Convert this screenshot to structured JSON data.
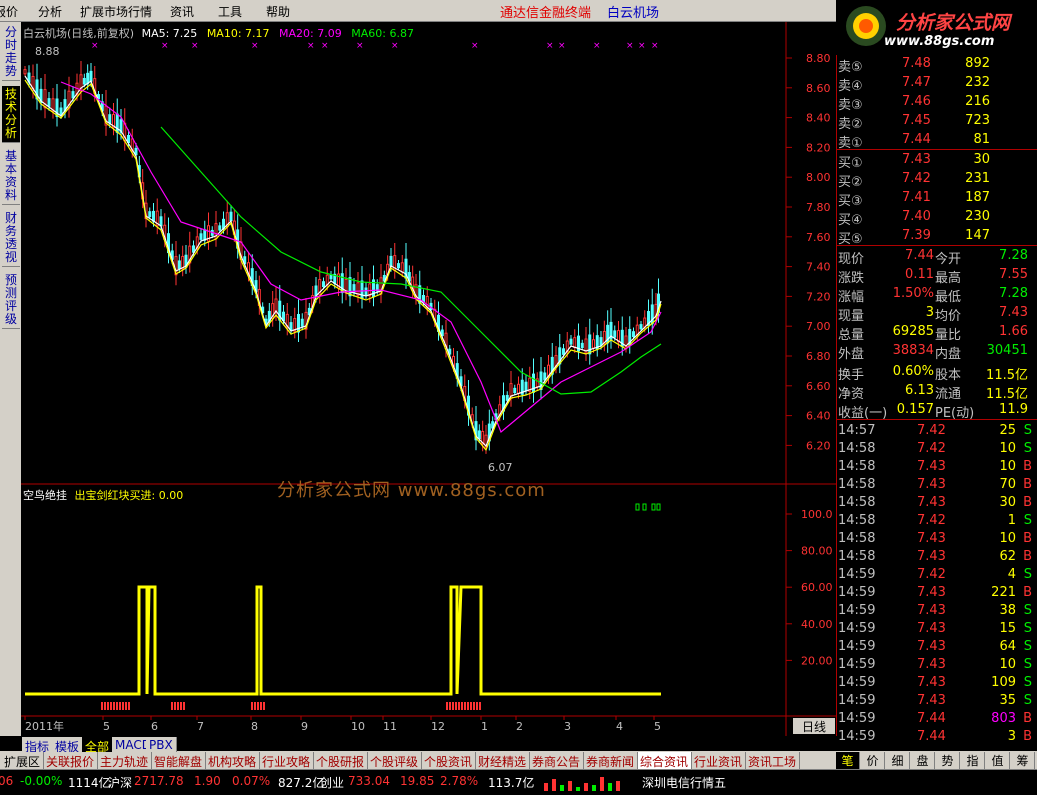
{
  "menu": {
    "items": [
      "报价",
      "分析",
      "扩展市场行情",
      "资讯",
      "工具",
      "帮助"
    ],
    "title": "通达信金融终端",
    "stock": "白云机场"
  },
  "logo": {
    "text": "分析家公式网",
    "url": "www.88gs.com"
  },
  "left_tabs": [
    "分时走势",
    "技术分析",
    "基本资料",
    "财务透视",
    "预测评级"
  ],
  "main_chart": {
    "header_name": "白云机场(日线,前复权)",
    "ma5": "MA5: 7.25",
    "ma10": "MA10: 7.17",
    "ma20": "MA20: 7.09",
    "ma60": "MA60: 6.87",
    "top_label": "8.88",
    "low_label": "6.07",
    "y_ticks": [
      "8.80",
      "8.60",
      "8.40",
      "8.20",
      "8.00",
      "7.80",
      "7.60",
      "7.40",
      "7.20",
      "7.00",
      "6.80",
      "6.60",
      "6.40",
      "6.20"
    ]
  },
  "indicator": {
    "name": "空鸟绝挂",
    "subtitle": "出宝剑红块买进: 0.00",
    "watermark": "分析家公式网 www.88gs.com",
    "y_ticks": [
      "100.0",
      "80.00",
      "60.00",
      "40.00",
      "20.00"
    ]
  },
  "date_axis": [
    "2011年",
    "5",
    "6",
    "7",
    "8",
    "9",
    "10",
    "11",
    "12",
    "1",
    "2",
    "3",
    "4",
    "5"
  ],
  "period": "日线",
  "ask": [
    {
      "label": "卖⑤",
      "price": "7.48",
      "vol": "892"
    },
    {
      "label": "卖④",
      "price": "7.47",
      "vol": "232"
    },
    {
      "label": "卖③",
      "price": "7.46",
      "vol": "216"
    },
    {
      "label": "卖②",
      "price": "7.45",
      "vol": "723"
    },
    {
      "label": "卖①",
      "price": "7.44",
      "vol": "81"
    }
  ],
  "bid": [
    {
      "label": "买①",
      "price": "7.43",
      "vol": "30"
    },
    {
      "label": "买②",
      "price": "7.42",
      "vol": "231"
    },
    {
      "label": "买③",
      "price": "7.41",
      "vol": "187"
    },
    {
      "label": "买④",
      "price": "7.40",
      "vol": "230"
    },
    {
      "label": "买⑤",
      "price": "7.39",
      "vol": "147"
    }
  ],
  "quote": [
    {
      "l1": "现价",
      "v1": "7.44",
      "c1": "#ff3333",
      "l2": "今开",
      "v2": "7.28",
      "c2": "#00ee00"
    },
    {
      "l1": "涨跌",
      "v1": "0.11",
      "c1": "#ff3333",
      "l2": "最高",
      "v2": "7.55",
      "c2": "#ff3333"
    },
    {
      "l1": "涨幅",
      "v1": "1.50%",
      "c1": "#ff3333",
      "l2": "最低",
      "v2": "7.28",
      "c2": "#00ee00"
    },
    {
      "l1": "现量",
      "v1": "3",
      "c1": "#ffff00",
      "l2": "均价",
      "v2": "7.43",
      "c2": "#ff3333"
    },
    {
      "l1": "总量",
      "v1": "69285",
      "c1": "#ffff00",
      "l2": "量比",
      "v2": "1.66",
      "c2": "#ff3333"
    },
    {
      "l1": "外盘",
      "v1": "38834",
      "c1": "#ff3333",
      "l2": "内盘",
      "v2": "30451",
      "c2": "#00ee00"
    },
    {
      "l1": "换手",
      "v1": "0.60%",
      "c1": "#ffff00",
      "l2": "股本",
      "v2": "11.5亿",
      "c2": "#ffff00"
    },
    {
      "l1": "净资",
      "v1": "6.13",
      "c1": "#ffff00",
      "l2": "流通",
      "v2": "11.5亿",
      "c2": "#ffff00"
    },
    {
      "l1": "收益(一)",
      "v1": "0.157",
      "c1": "#ffff00",
      "l2": "PE(动)",
      "v2": "11.9",
      "c2": "#ffff00"
    }
  ],
  "ticks": [
    {
      "t": "14:57",
      "p": "7.42",
      "v": "25",
      "s": "S"
    },
    {
      "t": "14:58",
      "p": "7.42",
      "v": "10",
      "s": "S"
    },
    {
      "t": "14:58",
      "p": "7.43",
      "v": "10",
      "s": "B"
    },
    {
      "t": "14:58",
      "p": "7.43",
      "v": "70",
      "s": "B"
    },
    {
      "t": "14:58",
      "p": "7.43",
      "v": "30",
      "s": "B"
    },
    {
      "t": "14:58",
      "p": "7.42",
      "v": "1",
      "s": "S"
    },
    {
      "t": "14:58",
      "p": "7.43",
      "v": "10",
      "s": "B"
    },
    {
      "t": "14:58",
      "p": "7.43",
      "v": "62",
      "s": "B"
    },
    {
      "t": "14:59",
      "p": "7.42",
      "v": "4",
      "s": "S"
    },
    {
      "t": "14:59",
      "p": "7.43",
      "v": "221",
      "s": "B"
    },
    {
      "t": "14:59",
      "p": "7.43",
      "v": "38",
      "s": "S"
    },
    {
      "t": "14:59",
      "p": "7.43",
      "v": "15",
      "s": "S"
    },
    {
      "t": "14:59",
      "p": "7.43",
      "v": "64",
      "s": "S"
    },
    {
      "t": "14:59",
      "p": "7.43",
      "v": "10",
      "s": "S"
    },
    {
      "t": "14:59",
      "p": "7.43",
      "v": "109",
      "s": "S"
    },
    {
      "t": "14:59",
      "p": "7.43",
      "v": "35",
      "s": "S"
    },
    {
      "t": "14:59",
      "p": "7.44",
      "v": "803",
      "s": "B"
    },
    {
      "t": "14:59",
      "p": "7.44",
      "v": "3",
      "s": "B"
    }
  ],
  "bottom_tabs": [
    "指标",
    "模板",
    "全部",
    "MACD",
    "PBX"
  ],
  "right_small_tabs": [
    "笔",
    "价",
    "细",
    "盘",
    "势",
    "指",
    "值",
    "筹"
  ],
  "function_tabs": [
    "扩展区",
    "关联报价",
    "主力轨迹",
    "智能解盘",
    "机构攻略",
    "行业攻略",
    "个股研报",
    "个股评级",
    "个股资讯",
    "财经精选",
    "券商公告",
    "券商新闻",
    "综合资讯",
    "行业资讯",
    "资讯工场"
  ],
  "status": {
    "pct": "-0.00%",
    "amt1": "1114亿",
    "label_sh": "沪深",
    "idx": "2717.78",
    "chg": "1.90",
    "chgp": "0.07%",
    "amt2": "827.2亿",
    "label_cy": "创业",
    "idx2": "733.04",
    "chg2": "19.85",
    "chgp2": "2.78%",
    "amt3": "113.7亿",
    "news": "深圳电信行情五"
  },
  "chart_data": {
    "type": "candlestick",
    "ylim": [
      6.07,
      8.88
    ],
    "ma_labels": [
      "MA5",
      "MA10",
      "MA20",
      "MA60"
    ]
  }
}
